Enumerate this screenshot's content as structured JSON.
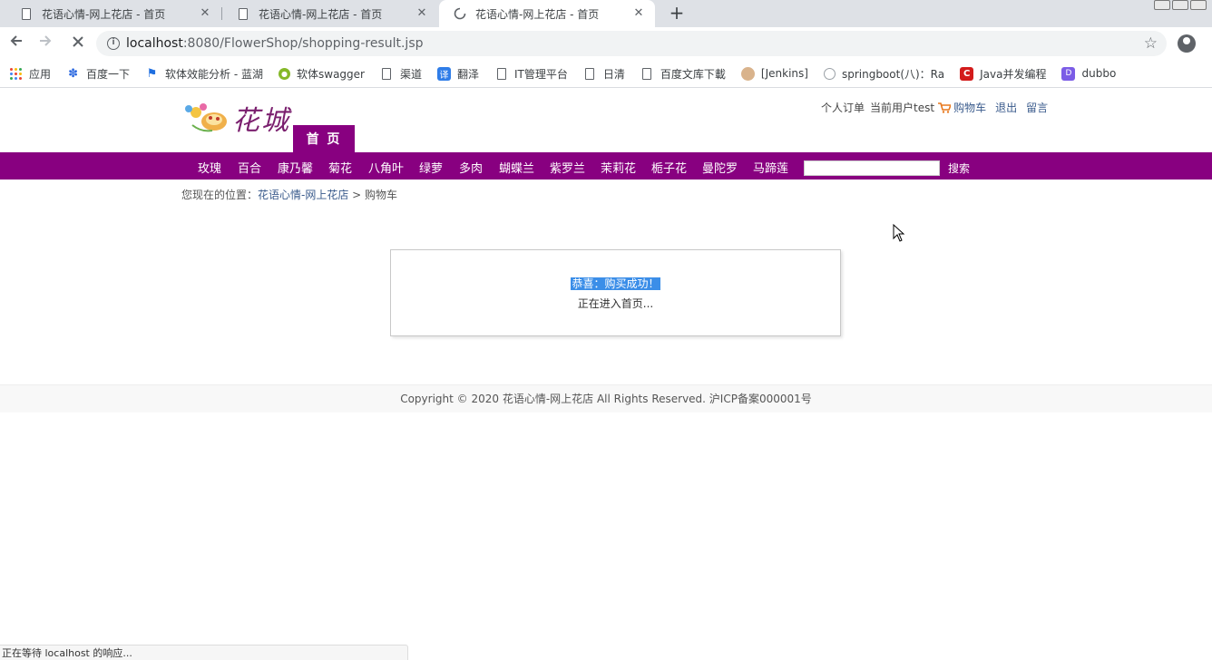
{
  "browser": {
    "tabs": [
      {
        "title": "花语心情-网上花店 - 首页",
        "active": false,
        "loading": false
      },
      {
        "title": "花语心情-网上花店 - 首页",
        "active": false,
        "loading": false
      },
      {
        "title": "花语心情-网上花店 - 首页",
        "active": true,
        "loading": true
      }
    ],
    "url": {
      "host": "localhost",
      "rest": ":8080/FlowerShop/shopping-result.jsp"
    },
    "bookmarks": [
      {
        "label": "应用",
        "icon": "apps-grid-icon"
      },
      {
        "label": "百度一下",
        "icon": "baidu-paw-icon"
      },
      {
        "label": "软体效能分析 - 蓝湖",
        "icon": "lanhu-icon"
      },
      {
        "label": "软体swagger",
        "icon": "swagger-icon"
      },
      {
        "label": "渠道",
        "icon": "page-icon"
      },
      {
        "label": "翻泽",
        "icon": "translate-icon"
      },
      {
        "label": "IT管理平台",
        "icon": "page-icon"
      },
      {
        "label": "日清",
        "icon": "page-icon"
      },
      {
        "label": "百度文库下載",
        "icon": "page-icon"
      },
      {
        "label": "[Jenkins]",
        "icon": "jenkins-icon"
      },
      {
        "label": "springboot(八)：Ra",
        "icon": "springboot-icon"
      },
      {
        "label": "Java并发编程",
        "icon": "csdn-icon"
      },
      {
        "label": "dubbo",
        "icon": "dubbo-icon"
      }
    ],
    "status_text": "正在等待 localhost 的响应..."
  },
  "site": {
    "logo_text": "花城",
    "home_tab": "首 页",
    "user_links": {
      "orders": "个人订单",
      "current_user": "当前用户test",
      "cart": "购物车",
      "logout": "退出",
      "message": "留言"
    },
    "categories": [
      "玫瑰",
      "百合",
      "康乃馨",
      "菊花",
      "八角叶",
      "绿萝",
      "多肉",
      "蝴蝶兰",
      "紫罗兰",
      "茉莉花",
      "栀子花",
      "曼陀罗",
      "马蹄莲"
    ],
    "search": {
      "value": "",
      "button": "搜索"
    },
    "breadcrumb": {
      "prefix": "您现在的位置：",
      "home": "花语心情-网上花店",
      "separator": " > ",
      "current": "购物车"
    },
    "result": {
      "title": "恭喜：购买成功！",
      "subtitle": "正在进入首页..."
    },
    "footer": "Copyright © 2020 花语心情-网上花店 All Rights Reserved. 沪ICP备案000001号"
  },
  "colors": {
    "brand": "#880080",
    "link": "#3a5b8c",
    "highlight": "#3b8ee8"
  }
}
